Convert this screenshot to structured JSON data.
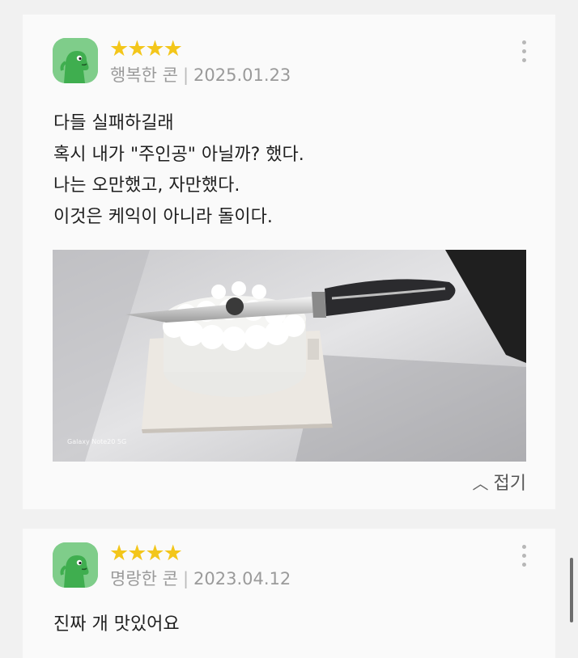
{
  "reviews": [
    {
      "rating_stars": "★★★★",
      "rating": 4,
      "author": "행복한 콘",
      "date": "2025.01.23",
      "text": "다들 실패하길래\n혹시 내가 \"주인공\" 아닐까? 했다.\n나는 오만했고, 자만했다.\n이것은 케익이 아니라 돌이다.",
      "photo_label": "Galaxy Note20 5G",
      "collapse_label": "접기",
      "avatar_icon": "green-dinosaur-icon",
      "more_icon": "more-vertical-icon"
    },
    {
      "rating_stars": "★★★★",
      "rating": 4,
      "author": "명랑한 콘",
      "date": "2023.04.12",
      "text": "진짜 개 맛있어요",
      "avatar_icon": "green-dinosaur-icon",
      "more_icon": "more-vertical-icon"
    }
  ],
  "colors": {
    "star": "#f3c61a",
    "avatar_bg": "#7fcd8a",
    "card_bg": "#fafafa",
    "page_bg": "#f1f1f1"
  },
  "separator": "|"
}
